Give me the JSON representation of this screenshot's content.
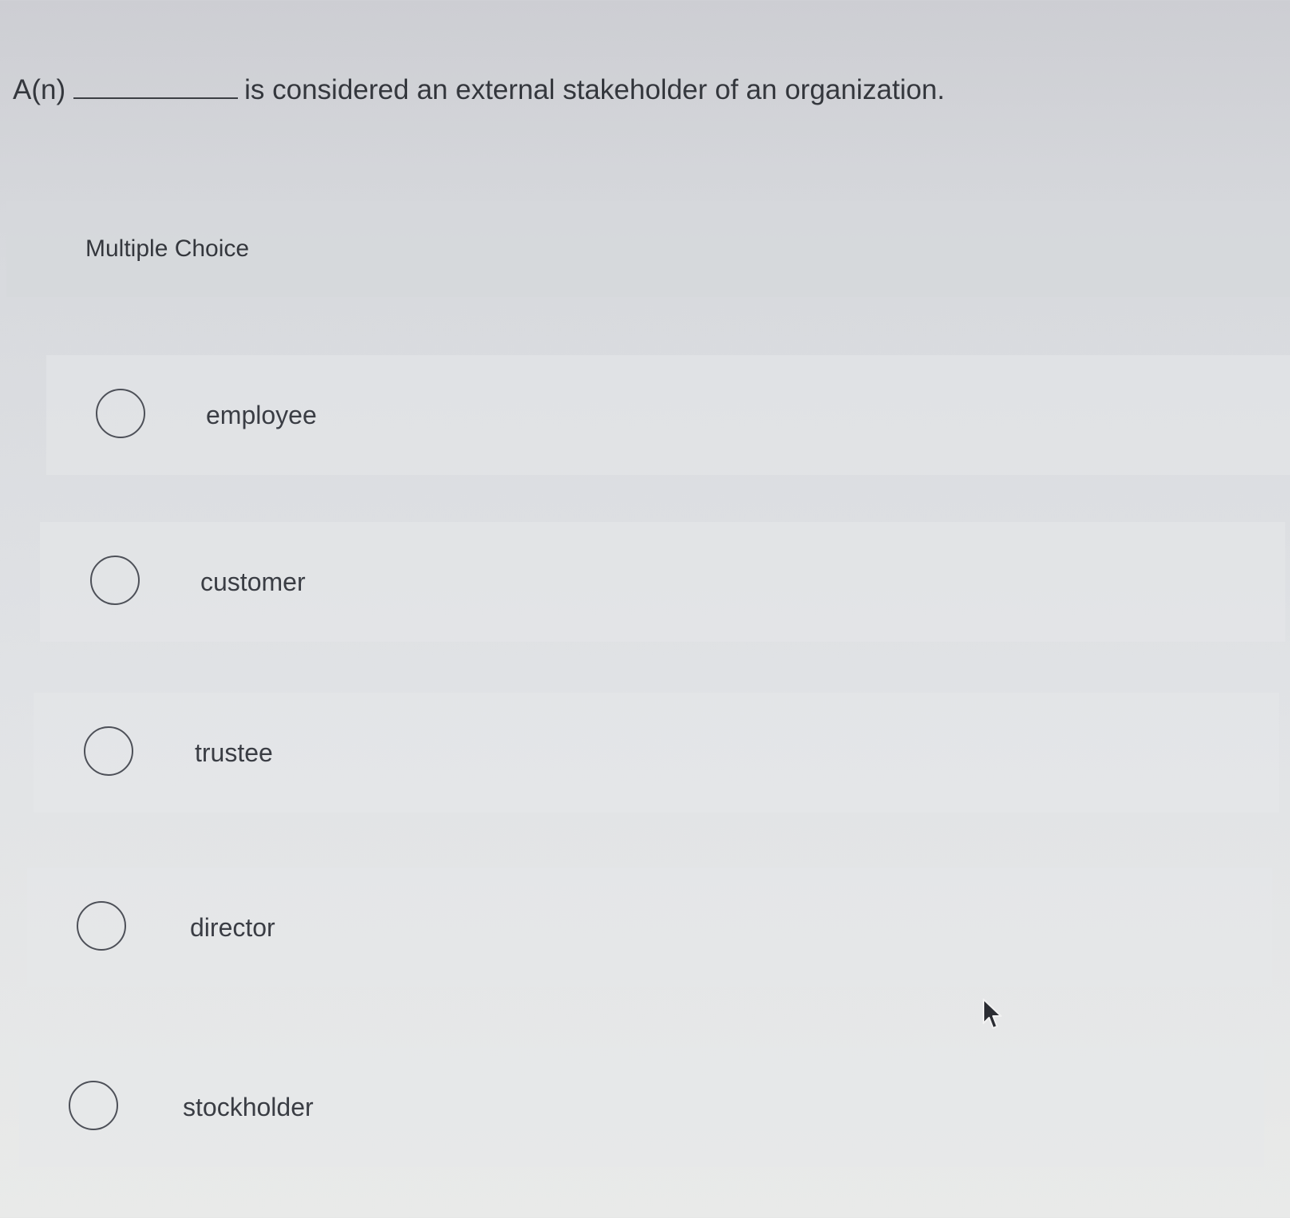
{
  "question": {
    "prefix": "A(n)",
    "suffix": "is considered an external stakeholder of an organization."
  },
  "multiple_choice": {
    "label": "Multiple Choice",
    "options": [
      {
        "label": "employee",
        "selected": false
      },
      {
        "label": "customer",
        "selected": false
      },
      {
        "label": "trustee",
        "selected": false
      },
      {
        "label": "director",
        "selected": false
      },
      {
        "label": "stockholder",
        "selected": false
      }
    ]
  },
  "icons": {
    "radio": "radio-unchecked-icon",
    "cursor": "mouse-pointer-icon"
  }
}
